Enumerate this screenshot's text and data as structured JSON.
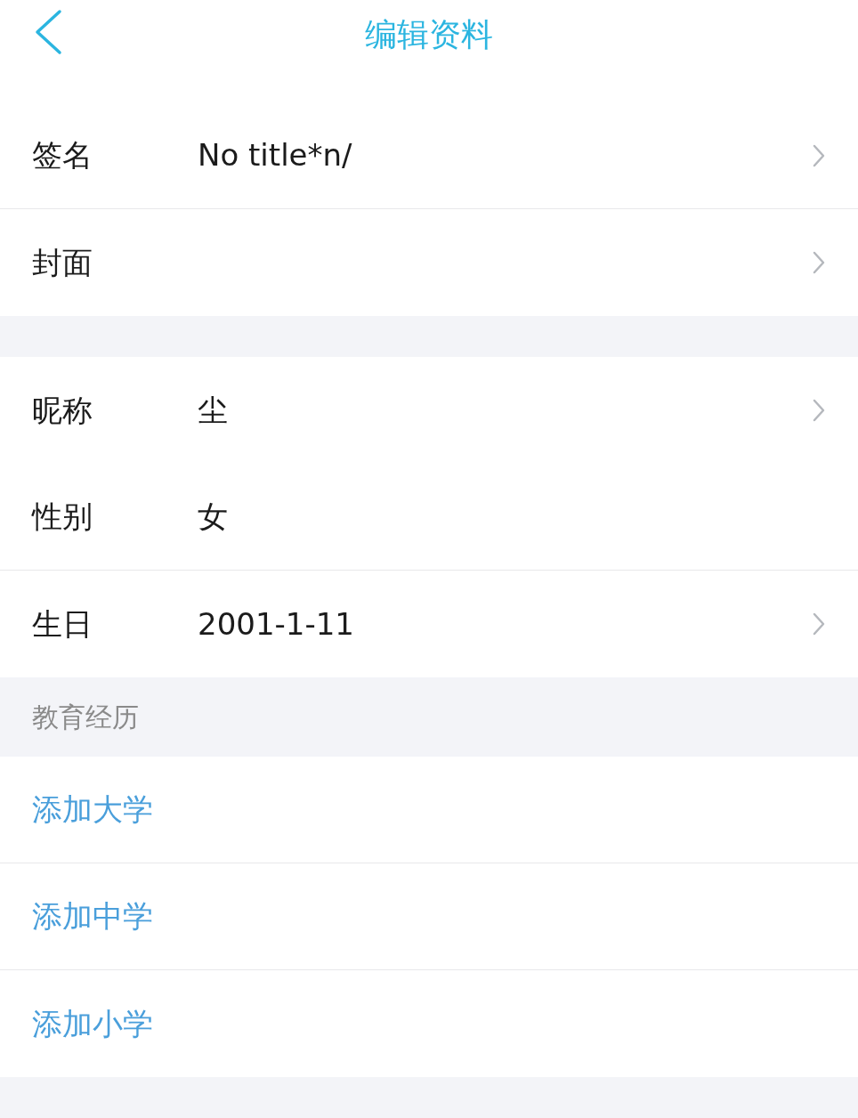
{
  "header": {
    "title": "编辑资料"
  },
  "blocks": [
    {
      "kind": "row",
      "label": "签名",
      "value": "No title*n/",
      "chevron": true,
      "divider": true
    },
    {
      "kind": "row",
      "label": "封面",
      "chevron": true,
      "divider": false
    },
    {
      "kind": "spacer"
    },
    {
      "kind": "row",
      "label": "昵称",
      "value": "尘",
      "chevron": true,
      "divider": false
    },
    {
      "kind": "row",
      "label": "性别",
      "value": "女",
      "chevron": false,
      "divider": true
    },
    {
      "kind": "row",
      "label": "生日",
      "value": "2001-1-11",
      "chevron": true,
      "divider": false
    },
    {
      "kind": "section_header",
      "label": "教育经历"
    },
    {
      "kind": "link",
      "label": "添加大学",
      "divider": true
    },
    {
      "kind": "link",
      "label": "添加中学",
      "divider": true
    },
    {
      "kind": "link",
      "label": "添加小学",
      "divider": false
    },
    {
      "kind": "spacer"
    }
  ]
}
